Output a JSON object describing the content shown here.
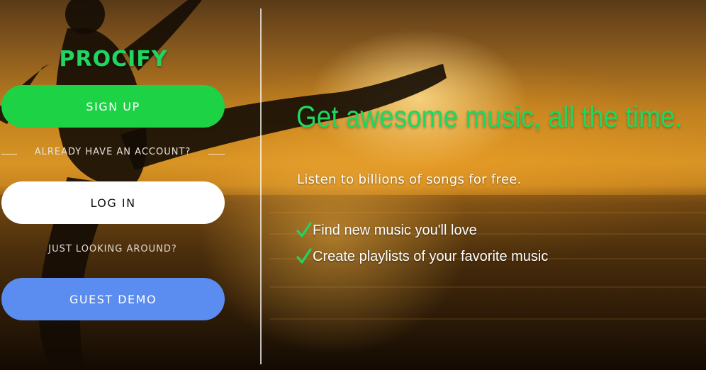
{
  "brand": {
    "name": "PROCIFY",
    "color": "#1ed760"
  },
  "auth": {
    "signup_label": "SIGN UP",
    "divider_text": "ALREADY HAVE AN ACCOUNT?",
    "login_label": "LOG IN",
    "looking_text": "JUST LOOKING AROUND?",
    "guest_label": "GUEST DEMO"
  },
  "hero": {
    "headline": "Get awesome music, all the time.",
    "subline": "Listen to billions of songs for free.",
    "features": [
      {
        "icon": "checkmark-icon",
        "text": "Find new music you'll love"
      },
      {
        "icon": "checkmark-icon",
        "text": "Create playlists of your favorite music"
      }
    ]
  },
  "colors": {
    "signup_button": "#1ed246",
    "login_button": "#ffffff",
    "guest_button": "#5b8cf0",
    "accent_green": "#1ed760"
  }
}
